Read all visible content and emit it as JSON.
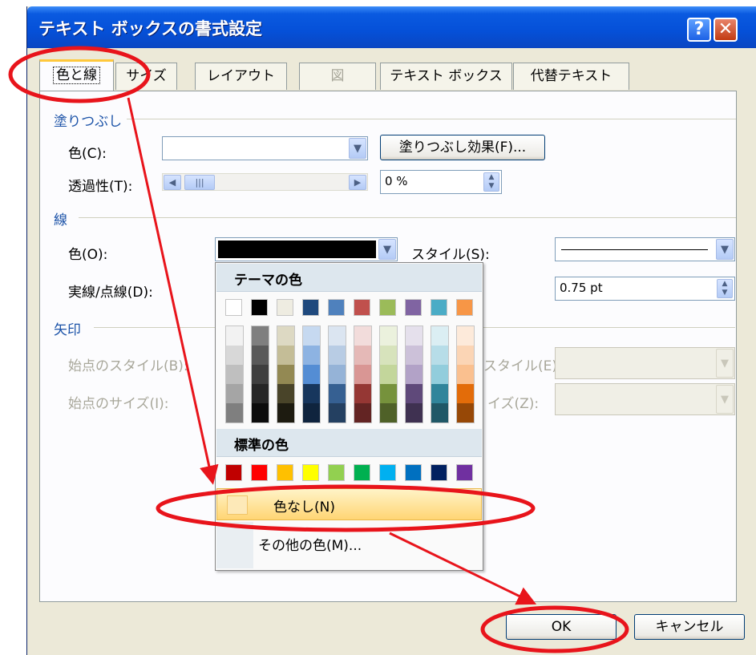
{
  "window": {
    "title": "テキスト ボックスの書式設定",
    "help_glyph": "?",
    "close_glyph": "✕"
  },
  "tabs": [
    {
      "label": "色と線",
      "active": true
    },
    {
      "label": "サイズ"
    },
    {
      "label": "レイアウト"
    },
    {
      "label": "図",
      "disabled": true
    },
    {
      "label": "テキスト ボックス"
    },
    {
      "label": "代替テキスト"
    }
  ],
  "fill": {
    "section": "塗りつぶし",
    "color_label": "色(C):",
    "effects_button": "塗りつぶし効果(F)...",
    "transparency_label": "透過性(T):",
    "transparency_value": "0 %"
  },
  "line": {
    "section": "線",
    "color_label": "色(O):",
    "style_label": "スタイル(S):",
    "dash_label": "実線/点線(D):",
    "weight_value": "0.75 pt"
  },
  "arrows": {
    "section": "矢印",
    "begin_style": "始点のスタイル(B):",
    "begin_size": "始点のサイズ(I):",
    "end_style": "スタイル(E):",
    "end_size": "イズ(Z):"
  },
  "color_popup": {
    "theme_header": "テーマの色",
    "standard_header": "標準の色",
    "no_color": "色なし(N)",
    "more_colors": "その他の色(M)...",
    "theme_colors": [
      "#ffffff",
      "#000000",
      "#eeece1",
      "#1f497d",
      "#4f81bd",
      "#c0504d",
      "#9bbb59",
      "#8064a2",
      "#4bacc6",
      "#f79646"
    ],
    "theme_shades": [
      [
        "#f2f2f2",
        "#d8d8d8",
        "#bfbfbf",
        "#a5a5a5",
        "#7f7f7f"
      ],
      [
        "#7f7f7f",
        "#595959",
        "#3f3f3f",
        "#262626",
        "#0c0c0c"
      ],
      [
        "#ddd9c3",
        "#c4bd97",
        "#938953",
        "#494429",
        "#1d1b10"
      ],
      [
        "#c6d9f0",
        "#8db3e2",
        "#548dd4",
        "#17365d",
        "#0f243e"
      ],
      [
        "#dbe5f1",
        "#b8cce4",
        "#95b3d7",
        "#366092",
        "#244061"
      ],
      [
        "#f2dcdb",
        "#e5b9b7",
        "#d99694",
        "#953734",
        "#632423"
      ],
      [
        "#ebf1dd",
        "#d7e3bc",
        "#c3d69b",
        "#76923c",
        "#4f6128"
      ],
      [
        "#e5e0ec",
        "#ccc1d9",
        "#b2a2c7",
        "#5f497a",
        "#3f3151"
      ],
      [
        "#dbeef3",
        "#b7dde8",
        "#92cddc",
        "#31859b",
        "#205867"
      ],
      [
        "#fdeada",
        "#fbd5b5",
        "#fac08f",
        "#e36c09",
        "#974806"
      ]
    ],
    "standard_colors": [
      "#c00000",
      "#ff0000",
      "#ffc000",
      "#ffff00",
      "#92d050",
      "#00b050",
      "#00b0f0",
      "#0070c0",
      "#002060",
      "#7030a0"
    ]
  },
  "buttons": {
    "ok": "OK",
    "cancel": "キャンセル"
  },
  "accent": {
    "annotation": "#e8141b"
  }
}
